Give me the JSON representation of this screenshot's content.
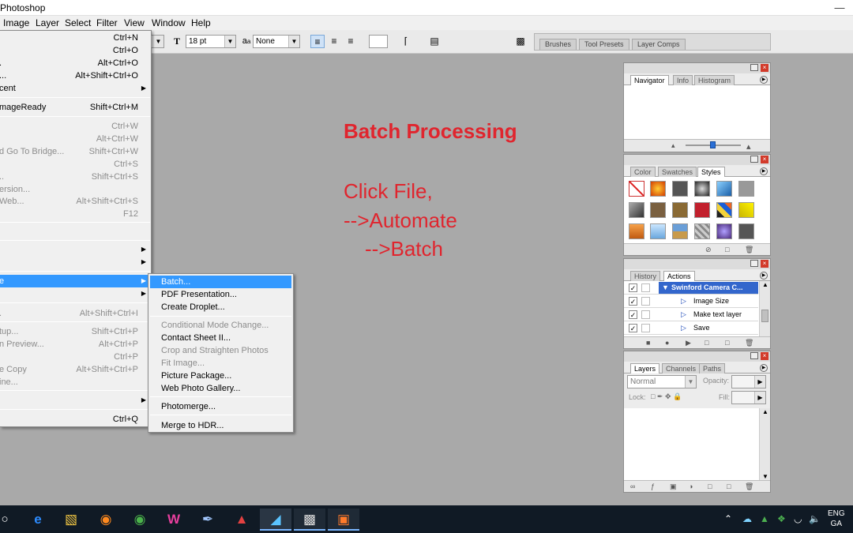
{
  "window": {
    "title": "Photoshop",
    "minimize_icon": "minimize-icon",
    "maximize_icon": "maximize-icon",
    "close_icon": "close-icon"
  },
  "menubar": [
    "Image",
    "Layer",
    "Select",
    "Filter",
    "View",
    "Window",
    "Help"
  ],
  "options_bar": {
    "font_size": "18 pt",
    "antialias_label": "a",
    "antialias_value": "None"
  },
  "wells": [
    "Brushes",
    "Tool Presets",
    "Layer Comps"
  ],
  "file_menu": [
    {
      "label": "",
      "shortcut": "Ctrl+N",
      "disabled": false
    },
    {
      "label": "",
      "shortcut": "Ctrl+O",
      "disabled": false
    },
    {
      "label": ".",
      "shortcut": "Alt+Ctrl+O",
      "disabled": false
    },
    {
      "label": "...",
      "shortcut": "Alt+Shift+Ctrl+O",
      "disabled": false
    },
    {
      "label": "cent",
      "shortcut": "",
      "submenu": true,
      "disabled": false
    },
    {
      "label": "mageReady",
      "shortcut": "Shift+Ctrl+M",
      "disabled": false
    },
    {
      "label": "",
      "shortcut": "Ctrl+W",
      "disabled": true
    },
    {
      "label": "",
      "shortcut": "Alt+Ctrl+W",
      "disabled": true
    },
    {
      "label": "d Go To Bridge...",
      "shortcut": "Shift+Ctrl+W",
      "disabled": true
    },
    {
      "label": "",
      "shortcut": "Ctrl+S",
      "disabled": true
    },
    {
      "label": "..",
      "shortcut": "Shift+Ctrl+S",
      "disabled": true
    },
    {
      "label": "ersion...",
      "shortcut": "",
      "disabled": true
    },
    {
      "label": "Web...",
      "shortcut": "Alt+Shift+Ctrl+S",
      "disabled": true
    },
    {
      "label": "",
      "shortcut": "F12",
      "disabled": true
    },
    {
      "label": "",
      "shortcut": "",
      "submenu": true,
      "disabled": false
    },
    {
      "label": "",
      "shortcut": "",
      "submenu": true,
      "disabled": false
    },
    {
      "label": "e",
      "shortcut": "",
      "submenu": true,
      "disabled": false,
      "highlighted": true
    },
    {
      "label": "",
      "shortcut": "",
      "submenu": true,
      "disabled": false
    },
    {
      "label": ".",
      "shortcut": "Alt+Shift+Ctrl+I",
      "disabled": true
    },
    {
      "label": "tup...",
      "shortcut": "Shift+Ctrl+P",
      "disabled": true
    },
    {
      "label": "n Preview...",
      "shortcut": "Alt+Ctrl+P",
      "disabled": true
    },
    {
      "label": "",
      "shortcut": "Ctrl+P",
      "disabled": true
    },
    {
      "label": "e Copy",
      "shortcut": "Alt+Shift+Ctrl+P",
      "disabled": true
    },
    {
      "label": "ine...",
      "shortcut": "",
      "disabled": true
    },
    {
      "label": "",
      "shortcut": "",
      "submenu": true,
      "disabled": false
    },
    {
      "label": "",
      "shortcut": "Ctrl+Q",
      "disabled": false
    }
  ],
  "automate_menu": [
    {
      "label": "Batch...",
      "highlighted": true,
      "disabled": false
    },
    {
      "label": "PDF Presentation...",
      "disabled": false
    },
    {
      "label": "Create Droplet...",
      "disabled": false
    },
    {
      "label": "Conditional Mode Change...",
      "disabled": true
    },
    {
      "label": "Contact Sheet II...",
      "disabled": false
    },
    {
      "label": "Crop and Straighten Photos",
      "disabled": true
    },
    {
      "label": "Fit Image...",
      "disabled": true
    },
    {
      "label": "Picture Package...",
      "disabled": false
    },
    {
      "label": "Web Photo Gallery...",
      "disabled": false
    },
    {
      "label": "Photomerge...",
      "disabled": false
    },
    {
      "label": "Merge to HDR...",
      "disabled": false
    }
  ],
  "annotation": {
    "title": "Batch Processing",
    "line1": "Click File,",
    "line2": "-->Automate",
    "line3": "-->Batch"
  },
  "panels": {
    "navigator": {
      "tabs": [
        "Navigator",
        "Info",
        "Histogram"
      ],
      "active": "Navigator",
      "zoom_level": 0.5
    },
    "styles": {
      "tabs": [
        "Color",
        "Swatches",
        "Styles"
      ],
      "active": "Styles"
    },
    "actions": {
      "tabs": [
        "History",
        "Actions"
      ],
      "active": "Actions",
      "set": "Swinford Camera C...",
      "items": [
        "Image Size",
        "Make text layer",
        "Save"
      ]
    },
    "layers": {
      "tabs": [
        "Layers",
        "Channels",
        "Paths"
      ],
      "active": "Layers",
      "blend_mode": "Normal",
      "opacity_label": "Opacity:",
      "lock_label": "Lock:",
      "fill_label": "Fill:"
    }
  },
  "taskbar": {
    "apps": [
      "start-icon",
      "search-icon",
      "edge-icon",
      "file-explorer-icon",
      "firefox-icon",
      "chrome-icon",
      "winamp-icon",
      "paint-icon",
      "sketchup-icon",
      "photoshop-icon",
      "image-viewer-icon",
      "app-icon"
    ],
    "tray": {
      "lang": "ENG",
      "region": "GA"
    }
  },
  "colors": {
    "menu_highlight": "#3399ff",
    "annotation": "#e0252e",
    "taskbar": "#101a25",
    "canvas": "#a9a9a9"
  }
}
